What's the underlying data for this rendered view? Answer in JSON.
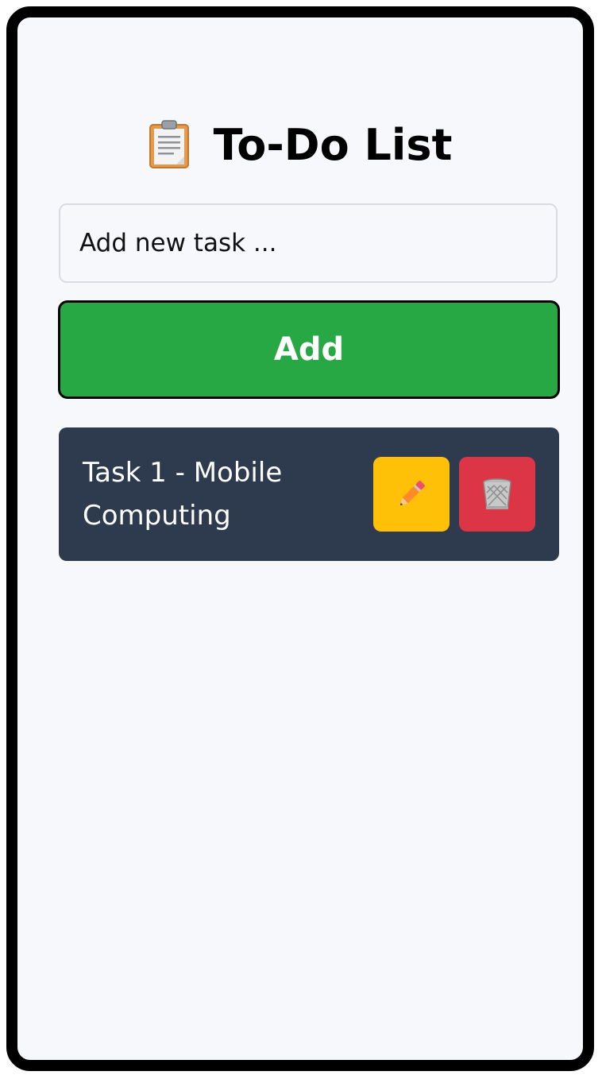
{
  "app": {
    "title": "To-Do List"
  },
  "input": {
    "placeholder": "Add new task ...",
    "value": ""
  },
  "add_button": {
    "label": "Add"
  },
  "tasks": [
    {
      "text": "Task 1 - Mobile Computing",
      "edit_icon": "pencil-icon",
      "delete_icon": "wastebasket-icon"
    }
  ],
  "colors": {
    "background": "#f6f8fb",
    "add_button": "#28a745",
    "task_item": "#2e3b4e",
    "edit_button": "#ffc107",
    "delete_button": "#dc3545"
  },
  "icons": {
    "header": "clipboard-icon"
  }
}
